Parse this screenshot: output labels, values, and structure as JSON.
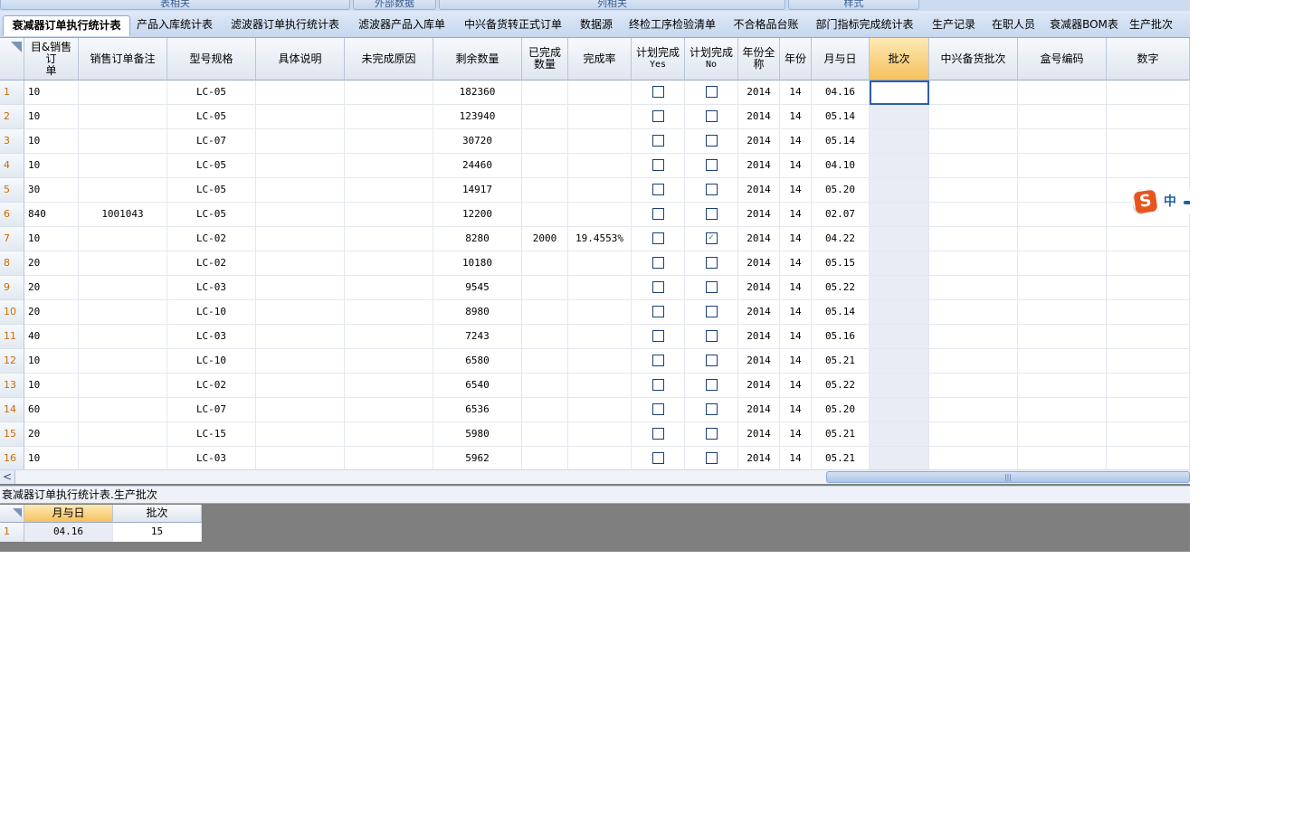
{
  "ribbon_groups": [
    {
      "label": "表相关"
    },
    {
      "label": "外部数据"
    },
    {
      "label": "列相关"
    },
    {
      "label": "样式"
    }
  ],
  "tabs": [
    {
      "label": "衰减器订单执行统计表",
      "active": true
    },
    {
      "label": "产品入库统计表"
    },
    {
      "label": "滤波器订单执行统计表"
    },
    {
      "label": "滤波器产品入库单"
    },
    {
      "label": "中兴备货转正式订单"
    },
    {
      "label": "数据源"
    },
    {
      "label": "终检工序检验清单"
    },
    {
      "label": "不合格品台账"
    },
    {
      "label": "部门指标完成统计表"
    },
    {
      "label": "生产记录"
    },
    {
      "label": "在职人员"
    },
    {
      "label": "衰减器BOM表"
    },
    {
      "label": "生产批次"
    }
  ],
  "grid": {
    "columns": [
      "目&销售订单",
      "销售订单备注",
      "型号规格",
      "具体说明",
      "未完成原因",
      "剩余数量",
      "已完成数量",
      "完成率",
      "计划完成Yes",
      "计划完成No",
      "年份全称",
      "年份",
      "月与日",
      "批次",
      "中兴备货批次",
      "盒号编码",
      "数字"
    ],
    "header_lines": [
      [
        "目&销售订",
        "单"
      ],
      [
        "销售订单备注"
      ],
      [
        "型号规格"
      ],
      [
        "具体说明"
      ],
      [
        "未完成原因"
      ],
      [
        "剩余数量"
      ],
      [
        "已完成",
        "数量"
      ],
      [
        "完成率"
      ],
      [
        "计划完成",
        "Yes"
      ],
      [
        "计划完成",
        "No"
      ],
      [
        "年份全",
        "称"
      ],
      [
        "年份"
      ],
      [
        "月与日"
      ],
      [
        "批次"
      ],
      [
        "中兴备货批次"
      ],
      [
        "盒号编码"
      ],
      [
        "数字"
      ]
    ],
    "selected_column": "批次",
    "rows": [
      {
        "n": "1",
        "qty": "10",
        "note": "",
        "model": "LC-05",
        "desc": "",
        "reason": "",
        "remain": "182360",
        "done": "",
        "rate": "",
        "yes": false,
        "no": false,
        "yearfull": "2014",
        "year": "14",
        "md": "04.16",
        "batch": "",
        "zx": "",
        "box": "",
        "num": ""
      },
      {
        "n": "2",
        "qty": "10",
        "note": "",
        "model": "LC-05",
        "desc": "",
        "reason": "",
        "remain": "123940",
        "done": "",
        "rate": "",
        "yes": false,
        "no": false,
        "yearfull": "2014",
        "year": "14",
        "md": "05.14",
        "batch": "",
        "zx": "",
        "box": "",
        "num": ""
      },
      {
        "n": "3",
        "qty": "10",
        "note": "",
        "model": "LC-07",
        "desc": "",
        "reason": "",
        "remain": "30720",
        "done": "",
        "rate": "",
        "yes": false,
        "no": false,
        "yearfull": "2014",
        "year": "14",
        "md": "05.14",
        "batch": "",
        "zx": "",
        "box": "",
        "num": ""
      },
      {
        "n": "4",
        "qty": "10",
        "note": "",
        "model": "LC-05",
        "desc": "",
        "reason": "",
        "remain": "24460",
        "done": "",
        "rate": "",
        "yes": false,
        "no": false,
        "yearfull": "2014",
        "year": "14",
        "md": "04.10",
        "batch": "",
        "zx": "",
        "box": "",
        "num": ""
      },
      {
        "n": "5",
        "qty": "30",
        "note": "",
        "model": "LC-05",
        "desc": "",
        "reason": "",
        "remain": "14917",
        "done": "",
        "rate": "",
        "yes": false,
        "no": false,
        "yearfull": "2014",
        "year": "14",
        "md": "05.20",
        "batch": "",
        "zx": "",
        "box": "",
        "num": ""
      },
      {
        "n": "6",
        "qty": "840",
        "note": "1001043",
        "model": "LC-05",
        "desc": "",
        "reason": "",
        "remain": "12200",
        "done": "",
        "rate": "",
        "yes": false,
        "no": false,
        "yearfull": "2014",
        "year": "14",
        "md": "02.07",
        "batch": "",
        "zx": "",
        "box": "",
        "num": ""
      },
      {
        "n": "7",
        "qty": "10",
        "note": "",
        "model": "LC-02",
        "desc": "",
        "reason": "",
        "remain": "8280",
        "done": "2000",
        "rate": "19.4553%",
        "yes": false,
        "no": true,
        "yearfull": "2014",
        "year": "14",
        "md": "04.22",
        "batch": "",
        "zx": "",
        "box": "",
        "num": ""
      },
      {
        "n": "8",
        "qty": "20",
        "note": "",
        "model": "LC-02",
        "desc": "",
        "reason": "",
        "remain": "10180",
        "done": "",
        "rate": "",
        "yes": false,
        "no": false,
        "yearfull": "2014",
        "year": "14",
        "md": "05.15",
        "batch": "",
        "zx": "",
        "box": "",
        "num": ""
      },
      {
        "n": "9",
        "qty": "20",
        "note": "",
        "model": "LC-03",
        "desc": "",
        "reason": "",
        "remain": "9545",
        "done": "",
        "rate": "",
        "yes": false,
        "no": false,
        "yearfull": "2014",
        "year": "14",
        "md": "05.22",
        "batch": "",
        "zx": "",
        "box": "",
        "num": ""
      },
      {
        "n": "10",
        "qty": "20",
        "note": "",
        "model": "LC-10",
        "desc": "",
        "reason": "",
        "remain": "8980",
        "done": "",
        "rate": "",
        "yes": false,
        "no": false,
        "yearfull": "2014",
        "year": "14",
        "md": "05.14",
        "batch": "",
        "zx": "",
        "box": "",
        "num": ""
      },
      {
        "n": "11",
        "qty": "40",
        "note": "",
        "model": "LC-03",
        "desc": "",
        "reason": "",
        "remain": "7243",
        "done": "",
        "rate": "",
        "yes": false,
        "no": false,
        "yearfull": "2014",
        "year": "14",
        "md": "05.16",
        "batch": "",
        "zx": "",
        "box": "",
        "num": ""
      },
      {
        "n": "12",
        "qty": "10",
        "note": "",
        "model": "LC-10",
        "desc": "",
        "reason": "",
        "remain": "6580",
        "done": "",
        "rate": "",
        "yes": false,
        "no": false,
        "yearfull": "2014",
        "year": "14",
        "md": "05.21",
        "batch": "",
        "zx": "",
        "box": "",
        "num": ""
      },
      {
        "n": "13",
        "qty": "10",
        "note": "",
        "model": "LC-02",
        "desc": "",
        "reason": "",
        "remain": "6540",
        "done": "",
        "rate": "",
        "yes": false,
        "no": false,
        "yearfull": "2014",
        "year": "14",
        "md": "05.22",
        "batch": "",
        "zx": "",
        "box": "",
        "num": ""
      },
      {
        "n": "14",
        "qty": "60",
        "note": "",
        "model": "LC-07",
        "desc": "",
        "reason": "",
        "remain": "6536",
        "done": "",
        "rate": "",
        "yes": false,
        "no": false,
        "yearfull": "2014",
        "year": "14",
        "md": "05.20",
        "batch": "",
        "zx": "",
        "box": "",
        "num": ""
      },
      {
        "n": "15",
        "qty": "20",
        "note": "",
        "model": "LC-15",
        "desc": "",
        "reason": "",
        "remain": "5980",
        "done": "",
        "rate": "",
        "yes": false,
        "no": false,
        "yearfull": "2014",
        "year": "14",
        "md": "05.21",
        "batch": "",
        "zx": "",
        "box": "",
        "num": ""
      },
      {
        "n": "16",
        "qty": "10",
        "note": "",
        "model": "LC-03",
        "desc": "",
        "reason": "",
        "remain": "5962",
        "done": "",
        "rate": "",
        "yes": false,
        "no": false,
        "yearfull": "2014",
        "year": "14",
        "md": "05.21",
        "batch": "",
        "zx": "",
        "box": "",
        "num": ""
      }
    ]
  },
  "scrollbar": {
    "left_arrow": "<",
    "thumb_grip": "|||"
  },
  "subpanel": {
    "title": "衰减器订单执行统计表.生产批次",
    "columns": [
      "月与日",
      "批次"
    ],
    "selected_column": "月与日",
    "rows": [
      {
        "n": "1",
        "md": "04.16",
        "batch": "15"
      }
    ]
  },
  "ime": {
    "logo": "S",
    "mode": "中"
  },
  "colors": {
    "selected_header": "#f6c15e",
    "row_number": "#c86d00",
    "checkbox_check": "#2a8a2a",
    "ime_logo": "#e8541f",
    "workspace": "#7f7f7f"
  }
}
